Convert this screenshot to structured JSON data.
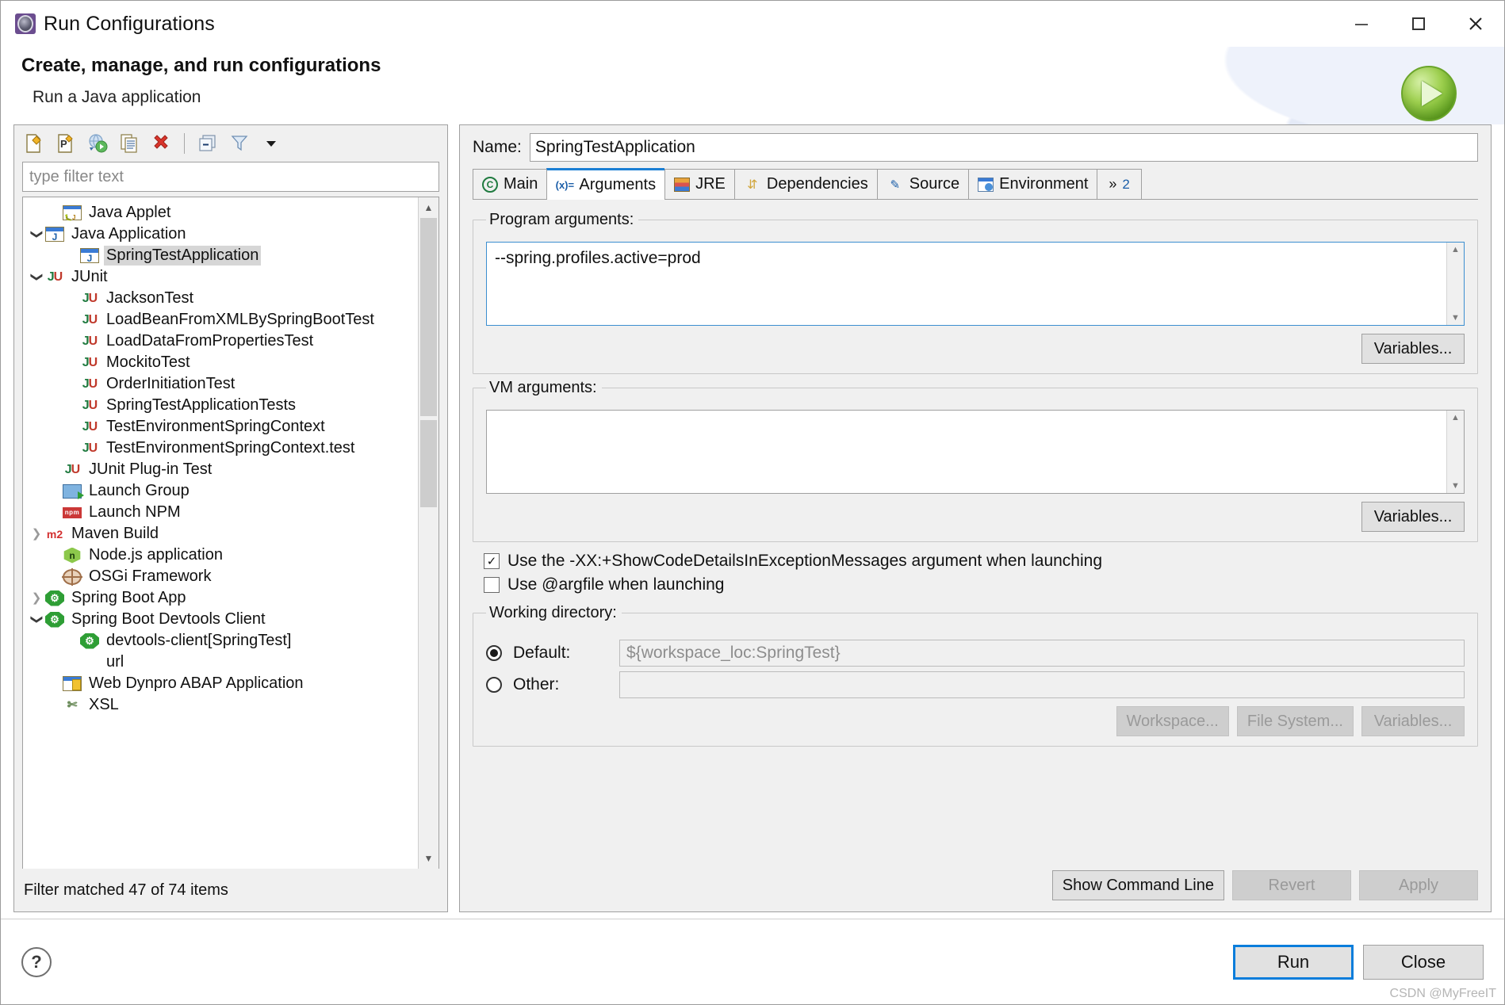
{
  "window": {
    "title": "Run Configurations",
    "icon": "run-configurations-icon",
    "minimize_label": "Minimize",
    "maximize_label": "Maximize",
    "close_label": "Close"
  },
  "header": {
    "title": "Create, manage, and run configurations",
    "subtitle": "Run a Java application",
    "decor_icon": "run-play-icon"
  },
  "left": {
    "toolbar": [
      {
        "name": "new-launch-configuration-icon",
        "glyph": "✧"
      },
      {
        "name": "new-prototype-icon",
        "glyph": "P"
      },
      {
        "name": "export-icon",
        "glyph": "▶"
      },
      {
        "name": "duplicate-icon",
        "glyph": "❐"
      },
      {
        "name": "delete-icon",
        "glyph": "✖"
      },
      {
        "name": "collapse-all-icon",
        "glyph": "−"
      },
      {
        "name": "filter-icon",
        "glyph": "▽"
      },
      {
        "name": "view-menu-icon",
        "glyph": "▼"
      }
    ],
    "filter_placeholder": "type filter text",
    "filter_value": "",
    "status": "Filter matched 47 of 74 items",
    "tree": [
      {
        "label": "Java Applet",
        "indent": 1,
        "twisty": "none",
        "icon": "java-applet-icon",
        "icon_class": "ic-applet",
        "selected": false
      },
      {
        "label": "Java Application",
        "indent": 0,
        "twisty": "open",
        "icon": "java-application-icon",
        "icon_class": "ic-java",
        "selected": false
      },
      {
        "label": "SpringTestApplication",
        "indent": 2,
        "twisty": "none",
        "icon": "java-application-icon",
        "icon_class": "ic-java",
        "selected": true
      },
      {
        "label": "JUnit",
        "indent": 0,
        "twisty": "open",
        "icon": "junit-icon",
        "icon_class": "ic-ju",
        "selected": false
      },
      {
        "label": "JacksonTest",
        "indent": 2,
        "twisty": "none",
        "icon": "junit-icon",
        "icon_class": "ic-ju",
        "selected": false
      },
      {
        "label": "LoadBeanFromXMLBySpringBootTest",
        "indent": 2,
        "twisty": "none",
        "icon": "junit-icon",
        "icon_class": "ic-ju",
        "selected": false
      },
      {
        "label": "LoadDataFromPropertiesTest",
        "indent": 2,
        "twisty": "none",
        "icon": "junit-icon",
        "icon_class": "ic-ju",
        "selected": false
      },
      {
        "label": "MockitoTest",
        "indent": 2,
        "twisty": "none",
        "icon": "junit-icon",
        "icon_class": "ic-ju",
        "selected": false
      },
      {
        "label": "OrderInitiationTest",
        "indent": 2,
        "twisty": "none",
        "icon": "junit-icon",
        "icon_class": "ic-ju",
        "selected": false
      },
      {
        "label": "SpringTestApplicationTests",
        "indent": 2,
        "twisty": "none",
        "icon": "junit-icon",
        "icon_class": "ic-ju",
        "selected": false
      },
      {
        "label": "TestEnvironmentSpringContext",
        "indent": 2,
        "twisty": "none",
        "icon": "junit-icon",
        "icon_class": "ic-ju",
        "selected": false
      },
      {
        "label": "TestEnvironmentSpringContext.test",
        "indent": 2,
        "twisty": "none",
        "icon": "junit-icon",
        "icon_class": "ic-ju",
        "selected": false
      },
      {
        "label": "JUnit Plug-in Test",
        "indent": 1,
        "twisty": "none",
        "icon": "junit-plugin-test-icon",
        "icon_class": "ic-plugin",
        "selected": false
      },
      {
        "label": "Launch Group",
        "indent": 1,
        "twisty": "none",
        "icon": "launch-group-icon",
        "icon_class": "ic-launchgrp",
        "selected": false
      },
      {
        "label": "Launch NPM",
        "indent": 1,
        "twisty": "none",
        "icon": "npm-icon",
        "icon_class": "ic-npm",
        "selected": false
      },
      {
        "label": "Maven Build",
        "indent": 0,
        "twisty": "closed",
        "icon": "maven-icon",
        "icon_class": "ic-m2",
        "selected": false
      },
      {
        "label": "Node.js application",
        "indent": 1,
        "twisty": "none",
        "icon": "nodejs-icon",
        "icon_class": "ic-node",
        "selected": false
      },
      {
        "label": "OSGi Framework",
        "indent": 1,
        "twisty": "none",
        "icon": "osgi-icon",
        "icon_class": "ic-osgi",
        "selected": false
      },
      {
        "label": "Spring Boot App",
        "indent": 0,
        "twisty": "closed",
        "icon": "spring-boot-icon",
        "icon_class": "ic-spring",
        "selected": false
      },
      {
        "label": "Spring Boot Devtools Client",
        "indent": 0,
        "twisty": "open",
        "icon": "spring-devtools-icon",
        "icon_class": "ic-spring",
        "selected": false
      },
      {
        "label": "devtools-client[SpringTest]",
        "indent": 2,
        "twisty": "none",
        "icon": "spring-devtools-icon",
        "icon_class": "ic-spring",
        "selected": false
      },
      {
        "label": "url",
        "indent": 2,
        "twisty": "none",
        "icon": "none",
        "icon_class": "ic-none",
        "selected": false
      },
      {
        "label": "Web Dynpro ABAP Application",
        "indent": 1,
        "twisty": "none",
        "icon": "web-dynpro-icon",
        "icon_class": "ic-webdynpro",
        "selected": false
      },
      {
        "label": "XSL",
        "indent": 1,
        "twisty": "none",
        "icon": "xsl-icon",
        "icon_class": "ic-xsl",
        "selected": false
      }
    ]
  },
  "right": {
    "name_label": "Name:",
    "name_value": "SpringTestApplication",
    "tabs": [
      {
        "label": "Main",
        "icon": "main-tab-icon",
        "icon_class": "ic-main",
        "glyph": "C",
        "active": false
      },
      {
        "label": "Arguments",
        "icon": "arguments-tab-icon",
        "icon_class": "ic-args",
        "glyph": "(x)=",
        "active": true
      },
      {
        "label": "JRE",
        "icon": "jre-tab-icon",
        "icon_class": "ic-jre",
        "glyph": "",
        "active": false
      },
      {
        "label": "Dependencies",
        "icon": "dependencies-tab-icon",
        "icon_class": "ic-deps",
        "glyph": "⇵",
        "active": false
      },
      {
        "label": "Source",
        "icon": "source-tab-icon",
        "icon_class": "ic-source",
        "glyph": "✎",
        "active": false
      },
      {
        "label": "Environment",
        "icon": "environment-tab-icon",
        "icon_class": "ic-env",
        "glyph": "",
        "active": false
      }
    ],
    "tab_overflow": "»",
    "tab_overflow_count": "2",
    "program_arguments": {
      "legend": "Program arguments:",
      "value": "--spring.profiles.active=prod",
      "variables_button": "Variables..."
    },
    "vm_arguments": {
      "legend": "VM arguments:",
      "value": "",
      "variables_button": "Variables..."
    },
    "checkboxes": [
      {
        "label": "Use the -XX:+ShowCodeDetailsInExceptionMessages argument when launching",
        "checked": true,
        "mark": "✓"
      },
      {
        "label": "Use @argfile when launching",
        "checked": false,
        "mark": ""
      }
    ],
    "working_directory": {
      "legend": "Working directory:",
      "default_label": "Default:",
      "default_value": "${workspace_loc:SpringTest}",
      "default_selected": true,
      "other_label": "Other:",
      "other_value": "",
      "other_selected": false,
      "buttons": [
        {
          "label": "Workspace...",
          "disabled": true
        },
        {
          "label": "File System...",
          "disabled": true
        },
        {
          "label": "Variables...",
          "disabled": true
        }
      ]
    },
    "bottom_buttons": [
      {
        "label": "Show Command Line",
        "disabled": false
      },
      {
        "label": "Revert",
        "disabled": true
      },
      {
        "label": "Apply",
        "disabled": true
      }
    ]
  },
  "footer": {
    "help_icon": "help-icon",
    "help_glyph": "?",
    "run_label": "Run",
    "close_label": "Close",
    "watermark": "CSDN @MyFreeIT"
  },
  "colors": {
    "accent": "#0a7ddb",
    "tab_active_border": "#1b7fd4",
    "panel_bg": "#f0f0f0",
    "selection": "#d6d6d6"
  }
}
